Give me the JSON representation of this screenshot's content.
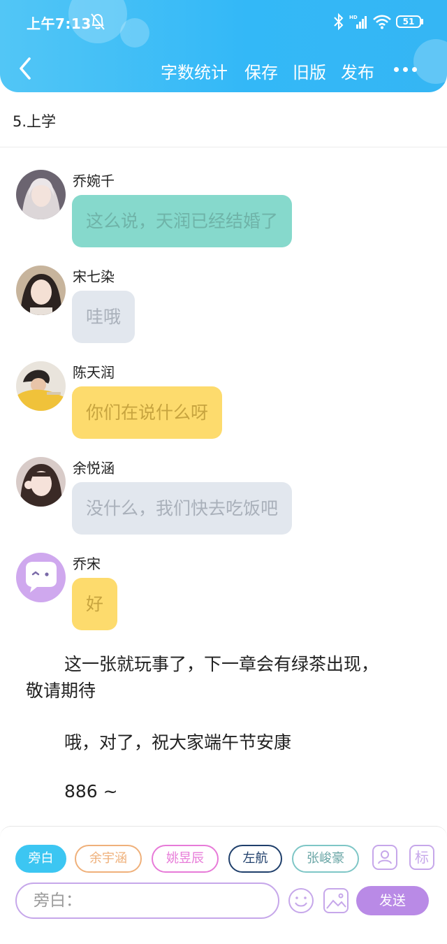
{
  "status_bar": {
    "time": "上午7:13",
    "battery": "51",
    "icons": [
      "mute-bell-icon",
      "bluetooth-icon",
      "hd-signal-icon",
      "wifi-icon",
      "battery-icon"
    ]
  },
  "nav": {
    "back_icon": "chevron-left-icon",
    "actions": [
      "字数统计",
      "保存",
      "旧版",
      "发布"
    ],
    "more_icon": "more-dots-icon"
  },
  "chapter": {
    "title": "5.上学"
  },
  "messages": [
    {
      "name": "乔婉千",
      "text": "这么说，天润已经结婚了",
      "bubble_color": "#86d9cc",
      "text_color": "#6fb3a8"
    },
    {
      "name": "宋七染",
      "text": "哇哦",
      "bubble_color": "#e2e7ee",
      "text_color": "#a9b0ba"
    },
    {
      "name": "陈天润",
      "text": "你们在说什么呀",
      "bubble_color": "#fddb6d",
      "text_color": "#c7a43f"
    },
    {
      "name": "余悦涵",
      "text": "没什么，我们快去吃饭吧",
      "bubble_color": "#e2e7ee",
      "text_color": "#a9b0ba"
    },
    {
      "name": "乔宋",
      "text": "好",
      "bubble_color": "#fddb6d",
      "text_color": "#c7a43f"
    }
  ],
  "narration": {
    "line1": "这一张就玩事了，下一章会有绿茶出现，",
    "line2": "敬请期待",
    "line3": "哦，对了，祝大家端午节安康",
    "line4": "886 ~"
  },
  "composer": {
    "roles": [
      {
        "label": "旁白",
        "color": "#3cc6f2",
        "active": true
      },
      {
        "label": "余宇涵",
        "color": "#efb07a",
        "active": false
      },
      {
        "label": "姚昱辰",
        "color": "#e77ad8",
        "active": false
      },
      {
        "label": "左航",
        "color": "#1f3f6b",
        "active": false
      },
      {
        "label": "张峻豪",
        "color": "#7ec6c6",
        "active": false
      }
    ],
    "role_manage_icon": "person-card-icon",
    "mark_button_label": "标",
    "input_placeholder": "旁白：",
    "emoji_icon": "smiley-icon",
    "image_icon": "image-icon",
    "send_label": "发送"
  },
  "colors": {
    "header_gradient_start": "#52c6f6",
    "header_gradient_end": "#35b6f4",
    "accent_purple": "#b98ae6"
  }
}
